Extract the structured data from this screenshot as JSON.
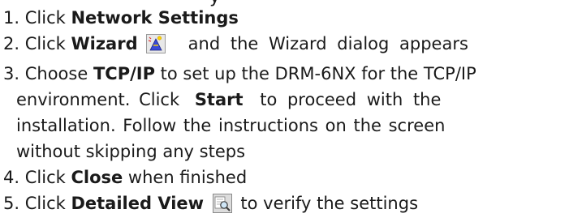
{
  "cut_top_text": "y",
  "steps": [
    {
      "number": "1.",
      "pre": "Click ",
      "bold": "Network Settings"
    },
    {
      "number": "2.",
      "pre": "Click ",
      "bold": "Wizard",
      "icon": "wizard-icon",
      "post": "and the Wizard dialog appears"
    },
    {
      "number": "3.",
      "line1_pre": "Choose ",
      "line1_bold": "TCP/IP",
      "line1_post": " to set up the DRM-6NX for the TCP/IP",
      "line2_pre": "environment. Click ",
      "line2_bold": "Start",
      "line2_post": " to proceed with the",
      "line3": "installation. Follow the instructions on the screen",
      "line4": "without skipping any steps"
    },
    {
      "number": "4.",
      "pre": "Click ",
      "bold": "Close",
      "post": " when finished"
    },
    {
      "number": "5.",
      "pre": "Click ",
      "bold": "Detailed View",
      "icon": "detailed-view-icon",
      "post": "to verify the settings"
    }
  ],
  "colors": {
    "text": "#1a1a1a",
    "background": "#ffffff"
  }
}
